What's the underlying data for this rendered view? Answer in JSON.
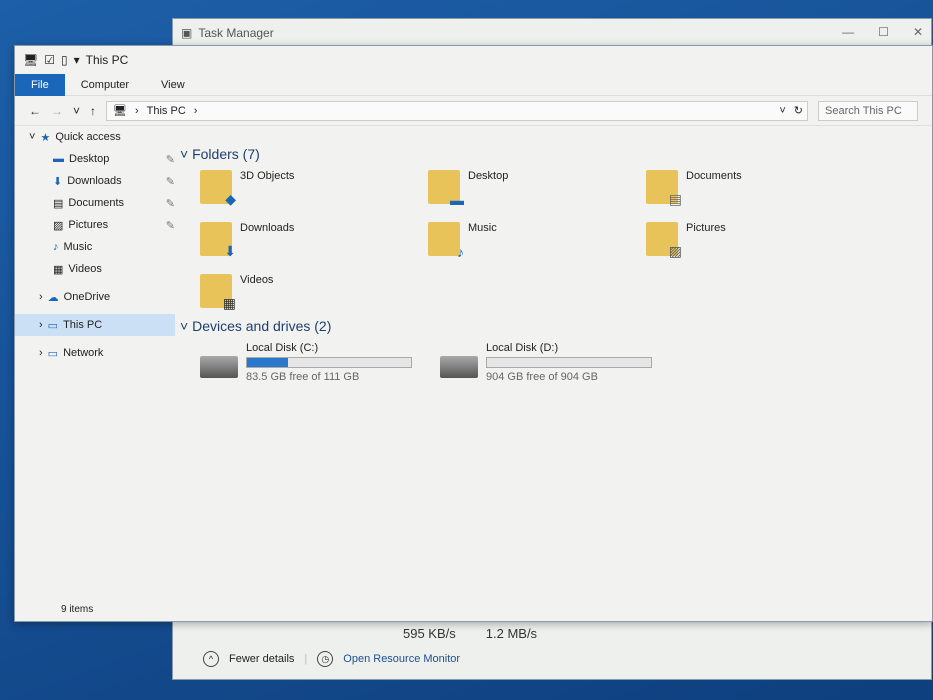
{
  "task_manager": {
    "title": "Task Manager",
    "speeds": [
      "595 KB/s",
      "1.2 MB/s"
    ],
    "fewer_details": "Fewer details",
    "open_resource_monitor": "Open Resource Monitor"
  },
  "explorer": {
    "title": "This PC",
    "ribbon_tabs": [
      "File",
      "Computer",
      "View"
    ],
    "address": "This PC",
    "search_placeholder": "Search This PC",
    "nav": [
      {
        "label": "Quick access",
        "icon": "star-icon"
      },
      {
        "label": "Desktop",
        "pinned": true
      },
      {
        "label": "Downloads",
        "pinned": true
      },
      {
        "label": "Documents",
        "pinned": true
      },
      {
        "label": "Pictures",
        "pinned": true
      },
      {
        "label": "Music"
      },
      {
        "label": "Videos"
      },
      {
        "label": "OneDrive"
      },
      {
        "label": "This PC",
        "selected": true
      },
      {
        "label": "Network"
      }
    ],
    "folders_header": "Folders (7)",
    "folders": [
      "3D Objects",
      "Desktop",
      "Documents",
      "Downloads",
      "Music",
      "Pictures",
      "Videos"
    ],
    "drives_header": "Devices and drives (2)",
    "drives": [
      {
        "name": "Local Disk (C:)",
        "free": "83.5 GB free of 111 GB",
        "used_fraction": 0.25
      },
      {
        "name": "Local Disk (D:)",
        "free": "904 GB free of 904 GB",
        "used_fraction": 0.0
      }
    ],
    "status": "9 items"
  }
}
